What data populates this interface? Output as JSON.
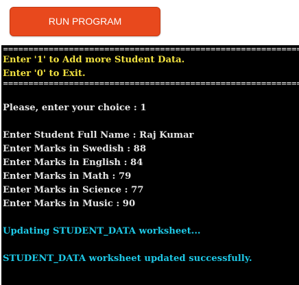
{
  "toolbar": {
    "run_label": "RUN PROGRAM"
  },
  "terminal": {
    "separator": "=============================================================================",
    "menu": {
      "option_add": "Enter '1' to Add more Student Data.",
      "option_exit": "Enter '0' to Exit."
    },
    "prompt_choice": "Please, enter your choice : 1",
    "entries": {
      "name": "Enter Student Full Name : Raj Kumar",
      "swedish": "Enter Marks in Swedish : 88",
      "english": "Enter Marks in English : 84",
      "math": "Enter Marks in Math : 79",
      "science": "Enter Marks in Science : 77",
      "music": "Enter Marks in Music : 90"
    },
    "status_updating": "Updating STUDENT_DATA worksheet...",
    "status_done": "STUDENT_DATA worksheet updated successfully."
  },
  "colors": {
    "button_bg": "#e8491d",
    "terminal_bg": "#000000",
    "text_default": "#e6e6e6",
    "text_yellow": "#f0e040",
    "text_cyan": "#1ec8e6"
  }
}
